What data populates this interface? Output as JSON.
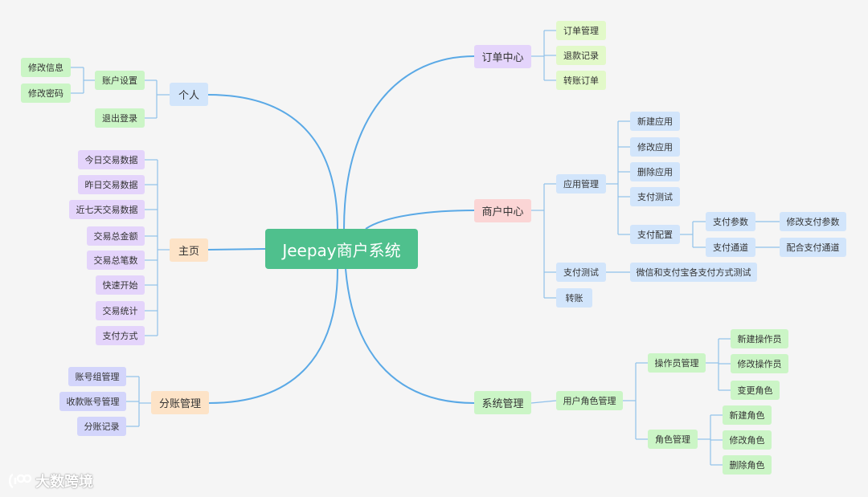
{
  "root": "Jeepay商户系统",
  "branches": {
    "personal": {
      "label": "个人",
      "account_settings": "账户设置",
      "edit_info": "修改信息",
      "edit_password": "修改密码",
      "logout": "退出登录"
    },
    "home": {
      "label": "主页",
      "items": [
        "今日交易数据",
        "昨日交易数据",
        "近七天交易数据",
        "交易总金额",
        "交易总笔数",
        "快速开始",
        "交易统计",
        "支付方式"
      ]
    },
    "split": {
      "label": "分账管理",
      "items": [
        "账号组管理",
        "收款账号管理",
        "分账记录"
      ]
    },
    "orders": {
      "label": "订单中心",
      "items": [
        "订单管理",
        "退款记录",
        "转账订单"
      ]
    },
    "merchant": {
      "label": "商户中心",
      "app_mgmt": "应用管理",
      "app_items": [
        "新建应用",
        "修改应用",
        "删除应用",
        "支付测试"
      ],
      "pay_config": "支付配置",
      "pay_params": "支付参数",
      "edit_pay_params": "修改支付参数",
      "pay_channel": "支付通道",
      "config_pay_channel": "配合支付通道",
      "pay_test": "支付测试",
      "pay_test_desc": "微信和支付宝各支付方式测试",
      "transfer": "转账"
    },
    "system": {
      "label": "系统管理",
      "user_role_mgmt": "用户角色管理",
      "operator_mgmt": "操作员管理",
      "operator_items": [
        "新建操作员",
        "修改操作员",
        "变更角色"
      ],
      "role_mgmt": "角色管理",
      "role_items": [
        "新建角色",
        "修改角色",
        "删除角色"
      ]
    }
  },
  "watermark": "大数跨境",
  "colors": {
    "root": "#4fc08d",
    "main_line": "#5aa9e6",
    "sub_line": "#8fc0ea",
    "background": "#f5f5f5"
  }
}
